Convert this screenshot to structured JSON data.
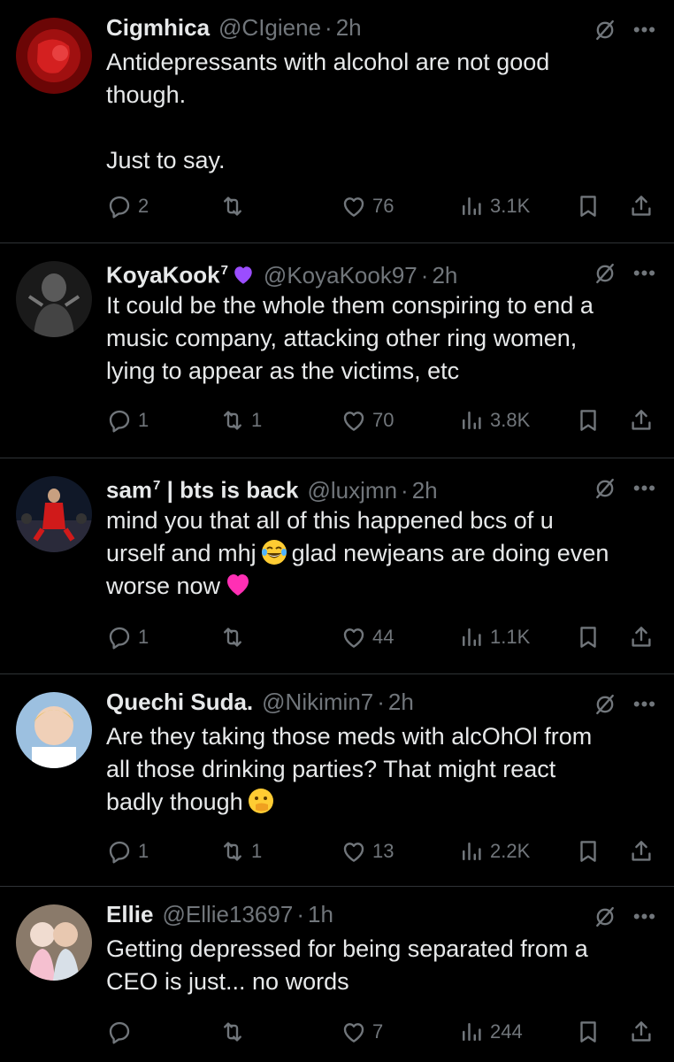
{
  "posts": [
    {
      "name": "Cigmhica",
      "name_sup": "",
      "handle": "@CIgiene",
      "time": "2h",
      "lines": [
        "Antidepressants with alcohol are not good",
        "though.",
        "",
        "Just to say."
      ],
      "replies": "2",
      "retweets": "",
      "likes": "76",
      "views": "3.1K",
      "avatar_color": "#7a0a0a"
    },
    {
      "name": "KoyaKook",
      "name_sup": "7",
      "handle": "@KoyaKook97",
      "time": "2h",
      "lines": [
        "It could be the whole them conspiring to end a",
        "music company, attacking other ring women,",
        "lying to appear as the victims, etc"
      ],
      "replies": "1",
      "retweets": "1",
      "likes": "70",
      "views": "3.8K",
      "avatar_color": "#2a2a2a"
    },
    {
      "name": "sam",
      "name_sup": "7",
      "name_suffix": " | bts is back",
      "handle": "@luxjmn",
      "time": "2h",
      "line1": "mind you that all of this happened bcs of u",
      "line2a": "urself and mhj",
      "line2b": "glad newjeans are doing even",
      "line3": "worse now",
      "replies": "1",
      "retweets": "",
      "likes": "44",
      "views": "1.1K",
      "avatar_color": "#1b2436"
    },
    {
      "name": "Quechi Suda.",
      "name_sup": "",
      "handle": "@Nikimin7",
      "time": "2h",
      "line1": "Are they taking those meds with alcOhOl from",
      "line2": "all those drinking parties? That might react",
      "line3": "badly though",
      "replies": "1",
      "retweets": "1",
      "likes": "13",
      "views": "2.2K",
      "avatar_color": "#8fb3d9"
    },
    {
      "name": "Ellie",
      "name_sup": "",
      "handle": "@Ellie13697",
      "time": "1h",
      "lines": [
        "Getting depressed for being separated from a",
        "CEO is just... no words"
      ],
      "replies": "",
      "retweets": "",
      "likes": "7",
      "views": "244",
      "avatar_color": "#c9b8a8"
    }
  ],
  "colors": {
    "background": "#000000",
    "text": "#e7e9ea",
    "muted": "#71767b",
    "divider": "#2f3336",
    "purple_heart": "#9b4dff",
    "pink_heart": "#ff2fb4"
  },
  "icons": [
    "reply-icon",
    "retweet-icon",
    "like-icon",
    "views-icon",
    "bookmark-icon",
    "share-icon",
    "grok-icon",
    "more-icon"
  ]
}
